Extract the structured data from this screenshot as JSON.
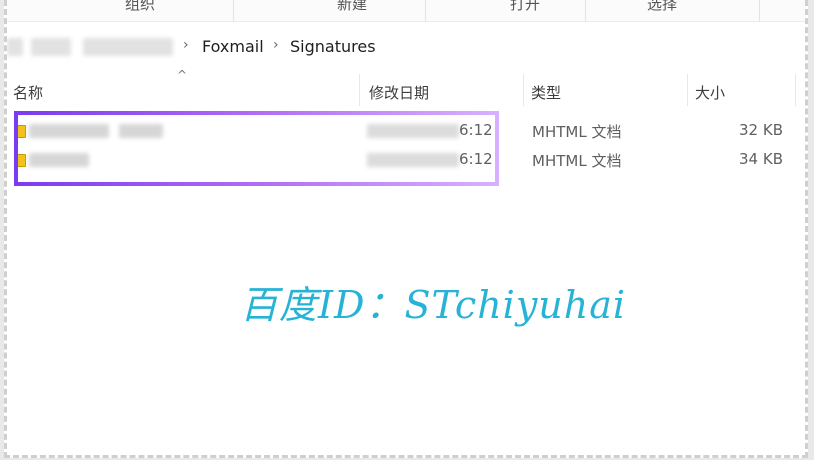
{
  "ribbon": {
    "items": [
      "组织",
      "新建",
      "打开",
      "选择"
    ]
  },
  "address": {
    "crumbs": [
      "Foxmail",
      "Signatures"
    ]
  },
  "columns": {
    "name": "名称",
    "modified": "修改日期",
    "type": "类型",
    "size": "大小"
  },
  "files": [
    {
      "time": "6:12",
      "type": "MHTML 文档",
      "size": "32 KB"
    },
    {
      "time": "6:12",
      "type": "MHTML 文档",
      "size": "34 KB"
    }
  ],
  "watermark": "百度ID：STchiyuhai",
  "colors": {
    "highlight_start": "#7a3cf0",
    "highlight_end": "#d7b0ff",
    "watermark": "#27b3d6",
    "file_icon": "#f2c21b"
  }
}
